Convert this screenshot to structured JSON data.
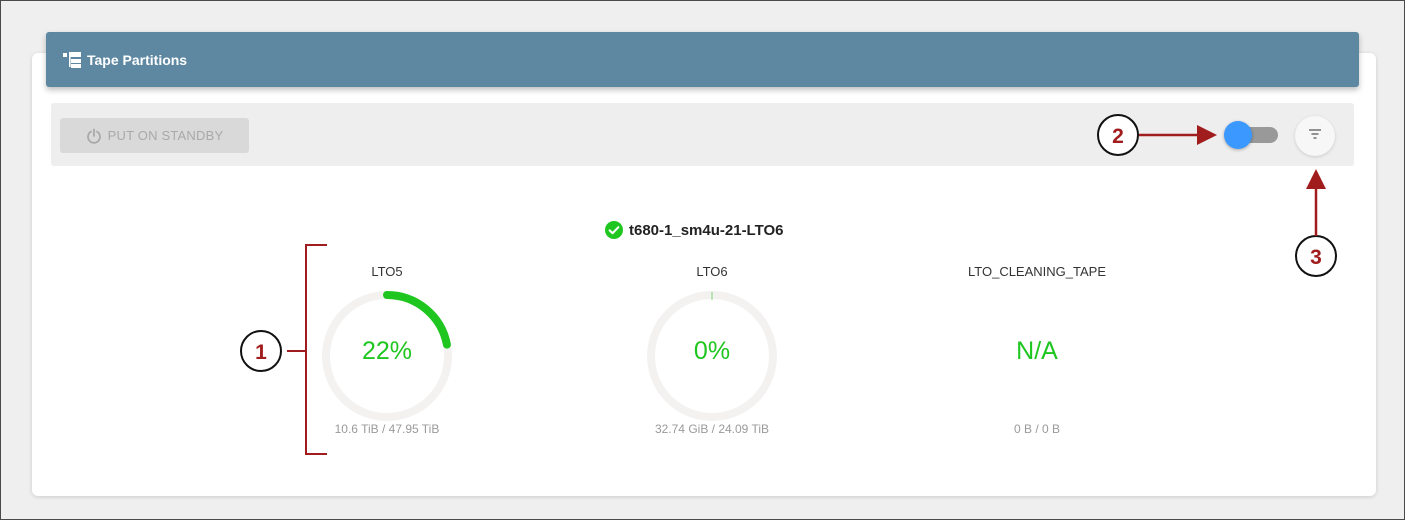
{
  "panel": {
    "title": "Tape Partitions"
  },
  "toolbar": {
    "standby_label": "PUT ON STANDBY"
  },
  "library": {
    "name": "t680-1_sm4u-21-LTO6",
    "status": "ok"
  },
  "gauges": [
    {
      "label": "LTO5",
      "percent_text": "22%",
      "percent": 22,
      "size_text": "10.6 TiB / 47.95 TiB"
    },
    {
      "label": "LTO6",
      "percent_text": "0%",
      "percent": 0,
      "size_text": "32.74 GiB / 24.09 TiB"
    },
    {
      "label": "LTO_CLEANING_TAPE",
      "percent_text": "N/A",
      "percent": null,
      "size_text": "0 B / 0 B"
    }
  ],
  "callouts": [
    "1",
    "2",
    "3"
  ],
  "colors": {
    "header": "#5e88a2",
    "gauge_fill": "#1fc61f",
    "gauge_track": "#f4f1f1",
    "toggle_thumb": "#3a98ff",
    "callout": "#a11d1d"
  },
  "icons": {
    "header": "partitions-icon",
    "standby": "power-icon",
    "status": "check-circle-icon",
    "filter": "filter-icon"
  }
}
